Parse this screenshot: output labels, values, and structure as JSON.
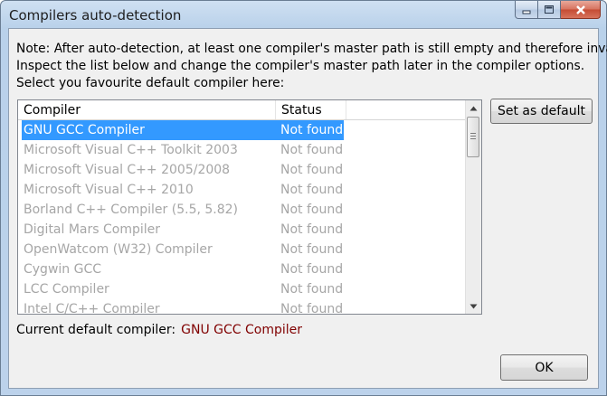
{
  "window": {
    "title": "Compilers auto-detection"
  },
  "note_lines": [
    "Note: After auto-detection, at least one compiler's master path is still empty and therefore invalid.",
    "Inspect the list below and change the compiler's master path later in the compiler options.",
    "Select you favourite default compiler here:"
  ],
  "list": {
    "columns": [
      "Compiler",
      "Status"
    ],
    "rows": [
      {
        "compiler": "GNU GCC Compiler",
        "status": "Not found",
        "selected": true
      },
      {
        "compiler": "Microsoft Visual C++ Toolkit 2003",
        "status": "Not found"
      },
      {
        "compiler": "Microsoft Visual C++ 2005/2008",
        "status": "Not found"
      },
      {
        "compiler": "Microsoft Visual C++ 2010",
        "status": "Not found"
      },
      {
        "compiler": "Borland C++ Compiler (5.5, 5.82)",
        "status": "Not found"
      },
      {
        "compiler": "Digital Mars Compiler",
        "status": "Not found"
      },
      {
        "compiler": "OpenWatcom (W32) Compiler",
        "status": "Not found"
      },
      {
        "compiler": "Cygwin GCC",
        "status": "Not found"
      },
      {
        "compiler": "LCC Compiler",
        "status": "Not found"
      },
      {
        "compiler": "Intel C/C++ Compiler",
        "status": "Not found"
      }
    ]
  },
  "buttons": {
    "set_default": "Set as default",
    "ok": "OK"
  },
  "current_default": {
    "label": "Current default compiler:",
    "value": "GNU GCC Compiler"
  },
  "colors": {
    "selection": "#3399ff",
    "current_value": "#800000"
  }
}
